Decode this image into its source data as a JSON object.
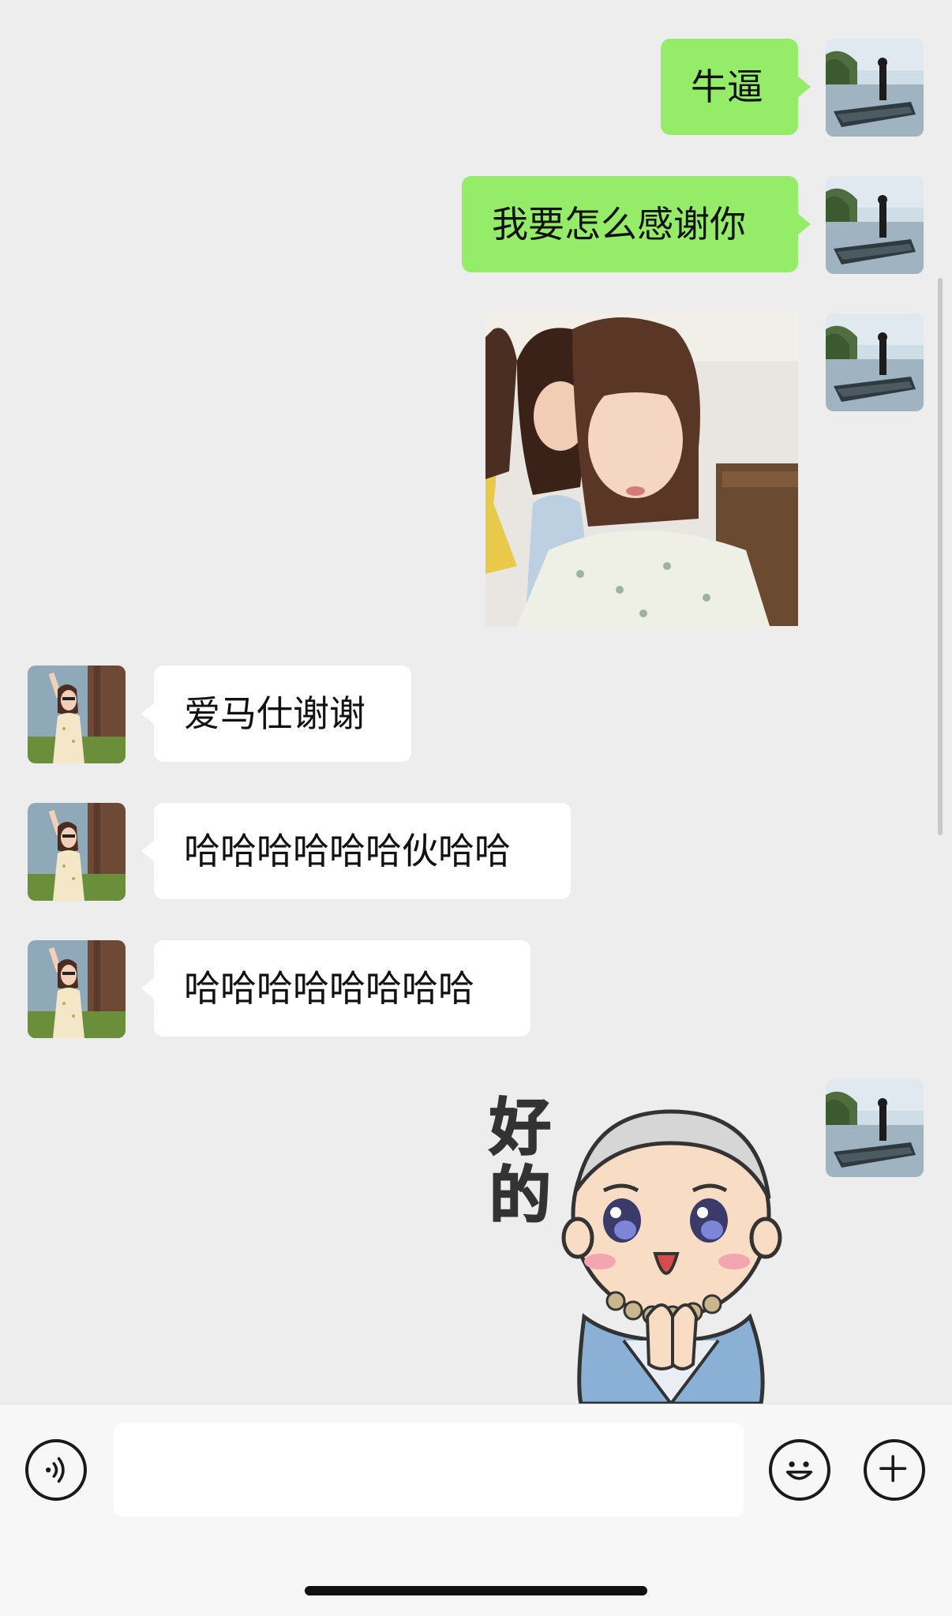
{
  "messages": [
    {
      "side": "me",
      "type": "text",
      "text": "牛逼"
    },
    {
      "side": "me",
      "type": "text",
      "text": "我要怎么感谢你"
    },
    {
      "side": "me",
      "type": "image",
      "description": "photo"
    },
    {
      "side": "them",
      "type": "text",
      "text": "爱马仕谢谢"
    },
    {
      "side": "them",
      "type": "text",
      "text": "哈哈哈哈哈哈伙哈哈"
    },
    {
      "side": "them",
      "type": "text",
      "text": "哈哈哈哈哈哈哈哈"
    },
    {
      "side": "me",
      "type": "sticker",
      "text": "好的"
    }
  ],
  "input": {
    "value": "",
    "placeholder": ""
  },
  "icons": {
    "voice": "voice-icon",
    "emoji": "emoji-icon",
    "plus": "plus-icon"
  },
  "colors": {
    "chat_bg": "#ededed",
    "my_bubble": "#95ec69",
    "their_bubble": "#ffffff",
    "input_bar": "#f7f7f7"
  }
}
